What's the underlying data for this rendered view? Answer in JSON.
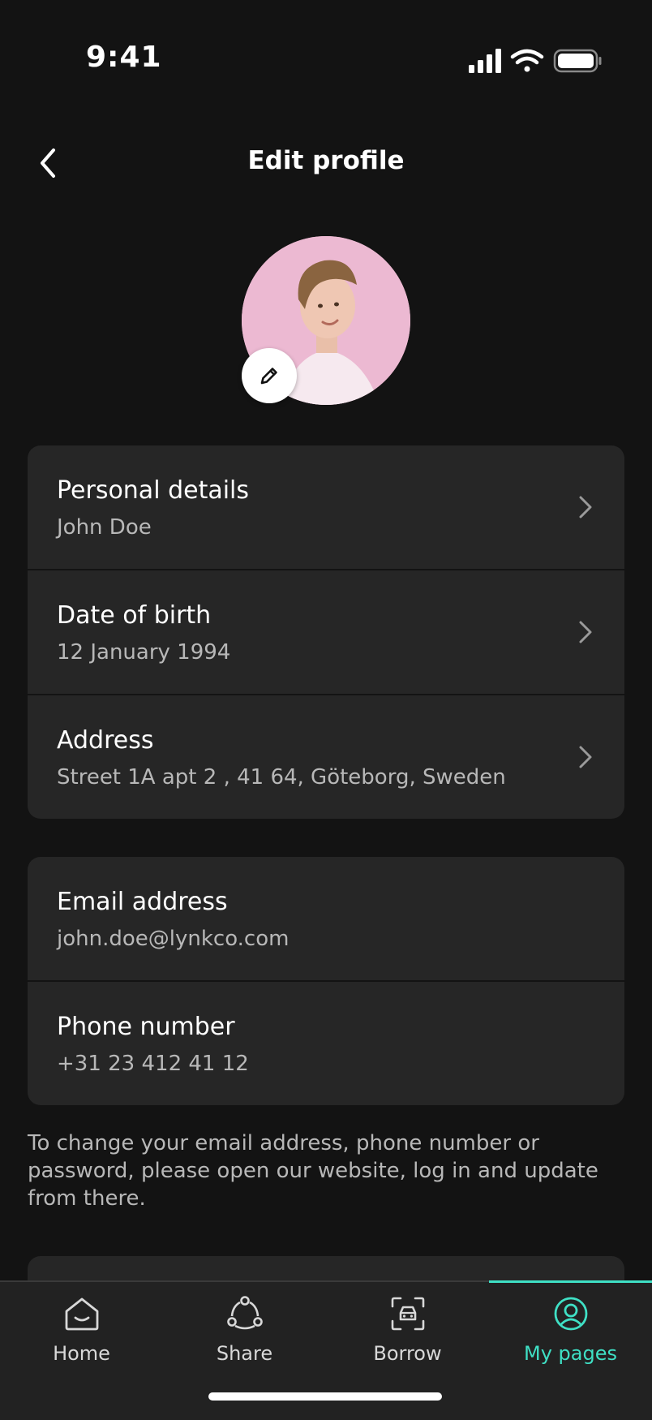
{
  "status_bar": {
    "time": "9:41"
  },
  "header": {
    "title": "Edit profile"
  },
  "profile_card": {
    "rows": [
      {
        "label": "Personal details",
        "value": "John Doe"
      },
      {
        "label": "Date of birth",
        "value": "12 January 1994"
      },
      {
        "label": "Address",
        "value": "Street 1A  apt 2 , 41 64, Göteborg, Sweden"
      }
    ]
  },
  "contact_card": {
    "rows": [
      {
        "label": "Email address",
        "value": "john.doe@lynkco.com"
      },
      {
        "label": "Phone number",
        "value": "+31 23 412 41 12"
      }
    ]
  },
  "info_text": "To change your email address, phone number or password, please open our website, log in and update from there.",
  "tab_bar": {
    "tabs": [
      {
        "label": "Home",
        "icon": "home-icon"
      },
      {
        "label": "Share",
        "icon": "share-icon"
      },
      {
        "label": "Borrow",
        "icon": "car-scan-icon"
      },
      {
        "label": "My pages",
        "icon": "user-circle-icon",
        "active": true
      }
    ]
  },
  "colors": {
    "accent": "#3fe0c5",
    "background": "#131313",
    "card": "#262626"
  }
}
